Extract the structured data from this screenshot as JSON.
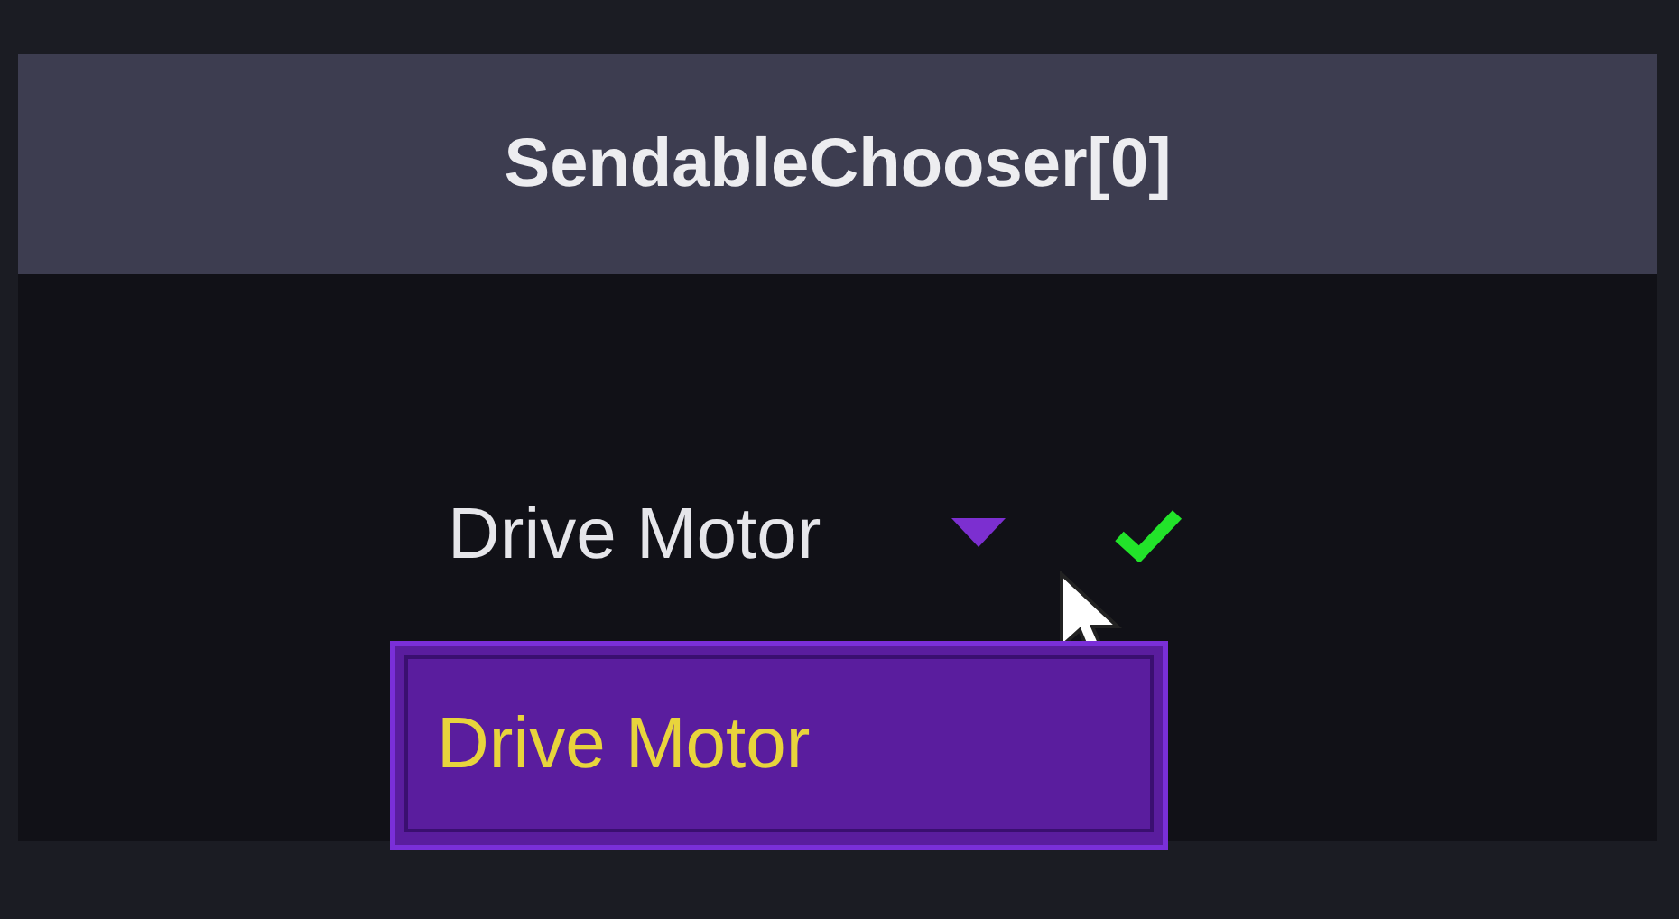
{
  "widget": {
    "title": "SendableChooser[0]"
  },
  "chooser": {
    "value": "Drive Motor",
    "confirmed": true,
    "expanded": true,
    "options": [
      {
        "label": "Drive Motor",
        "selected": true
      }
    ]
  }
}
